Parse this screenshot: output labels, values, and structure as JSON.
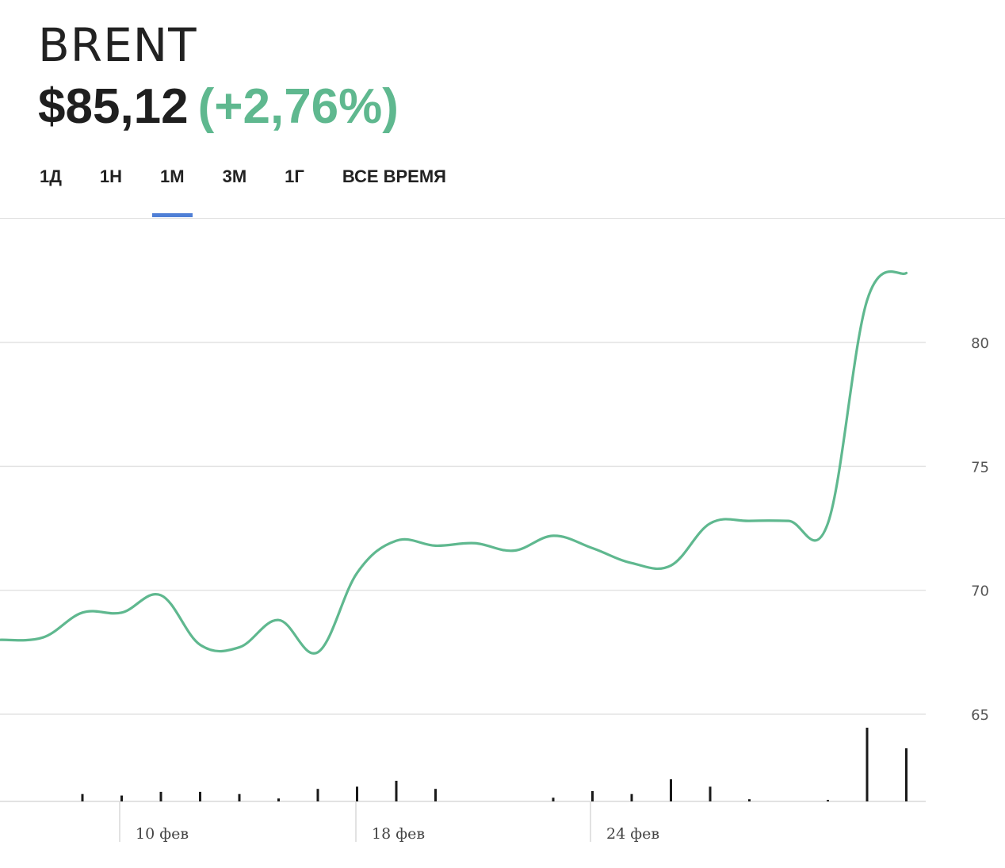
{
  "header": {
    "ticker": "BRENT",
    "price": "$85,12",
    "change": "(+2,76%)"
  },
  "tabs": [
    {
      "label": "1Д",
      "active": false
    },
    {
      "label": "1Н",
      "active": false
    },
    {
      "label": "1М",
      "active": true
    },
    {
      "label": "3М",
      "active": false
    },
    {
      "label": "1Г",
      "active": false
    },
    {
      "label": "ВСЕ ВРЕМЯ",
      "active": false
    }
  ],
  "colors": {
    "line": "#5fb88f",
    "accent": "#4f7fd6",
    "positive": "#5fb88f"
  },
  "chart_data": {
    "type": "line",
    "title": "",
    "xlabel": "",
    "ylabel": "",
    "ylim": [
      63.2,
      84.5
    ],
    "y_ticks": [
      65,
      70,
      75,
      80
    ],
    "x_tick_labels": [
      "10 фев",
      "18 фев",
      "24 фев"
    ],
    "grid": true,
    "series": [
      {
        "values": [
          68.0,
          68.1,
          69.1,
          69.1,
          69.8,
          67.8,
          67.7,
          68.8,
          67.5,
          70.7,
          72.0,
          71.8,
          71.9,
          71.6,
          72.2,
          71.7,
          71.1,
          71.0,
          72.7,
          72.8,
          72.8,
          72.7,
          81.7,
          82.8
        ]
      }
    ],
    "volume": {
      "values": [
        0,
        0,
        0.1,
        0.08,
        0.13,
        0.13,
        0.1,
        0.04,
        0.17,
        0.2,
        0.28,
        0.17,
        0,
        0,
        0.05,
        0.14,
        0.1,
        0.3,
        0.2,
        0.03,
        0,
        0.02,
        1.0,
        0.72
      ]
    }
  }
}
